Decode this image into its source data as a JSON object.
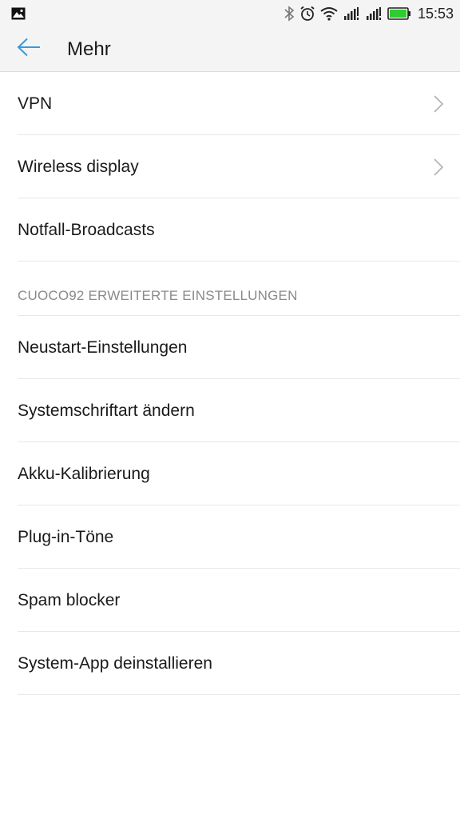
{
  "status_bar": {
    "time": "15:53",
    "icons": [
      "image-notification-icon",
      "bluetooth-icon",
      "alarm-icon",
      "wifi-icon",
      "signal-sim1-icon",
      "signal-sim2-icon",
      "battery-icon"
    ],
    "battery_color": "#2ecc2e"
  },
  "header": {
    "title": "Mehr",
    "accent_color": "#3a9ad9"
  },
  "list": {
    "group1": [
      {
        "label": "VPN",
        "has_chevron": true
      },
      {
        "label": "Wireless display",
        "has_chevron": true
      },
      {
        "label": "Notfall-Broadcasts",
        "has_chevron": false
      }
    ],
    "section_title": "CUOCO92 ERWEITERTE EINSTELLUNGEN",
    "group2": [
      {
        "label": "Neustart-Einstellungen"
      },
      {
        "label": "Systemschriftart ändern"
      },
      {
        "label": "Akku-Kalibrierung"
      },
      {
        "label": "Plug-in-Töne"
      },
      {
        "label": "Spam blocker"
      },
      {
        "label": "System-App deinstallieren"
      }
    ]
  }
}
